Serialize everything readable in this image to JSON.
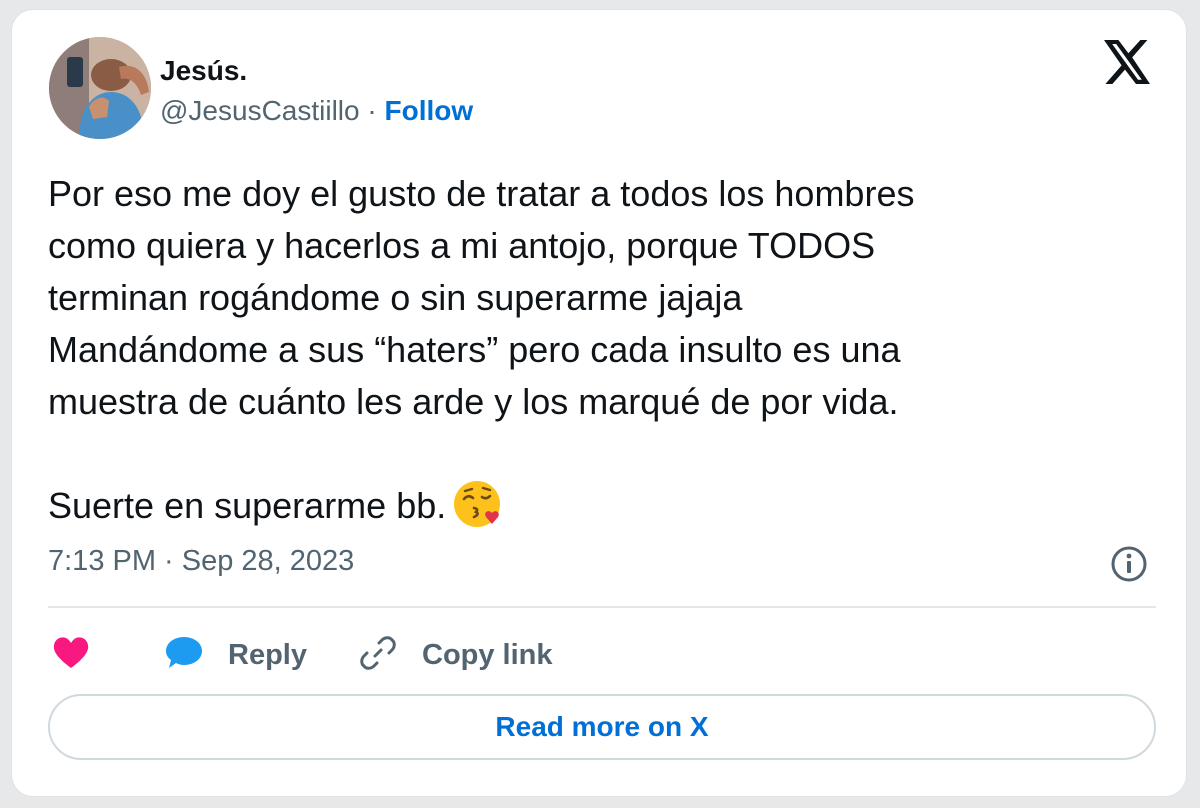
{
  "author": {
    "display_name": "Jesús.",
    "handle": "@JesusCastiillo",
    "separator": "·",
    "follow_label": "Follow"
  },
  "tweet": {
    "text": "Por eso me doy el gusto de tratar a todos los hombres\ncomo quiera y hacerlos a mi antojo, porque TODOS\nterminan rogándome o sin superarme jajaja\nMandándome a sus “haters” pero cada insulto es una\nmuestra de cuánto les arde y los marqué de por vida.\n\nSuerte en superarme bb.",
    "emoji": "face-blowing-kiss",
    "timestamp": "7:13 PM · Sep 28, 2023"
  },
  "actions": {
    "like_icon": "heart-icon",
    "reply_label": "Reply",
    "copy_label": "Copy link"
  },
  "footer": {
    "read_more_label": "Read more on X"
  },
  "colors": {
    "accent": "#006fd6",
    "heart": "#f91880",
    "reply_bubble": "#1d9bf0",
    "muted": "#536471",
    "text": "#0f1419"
  }
}
